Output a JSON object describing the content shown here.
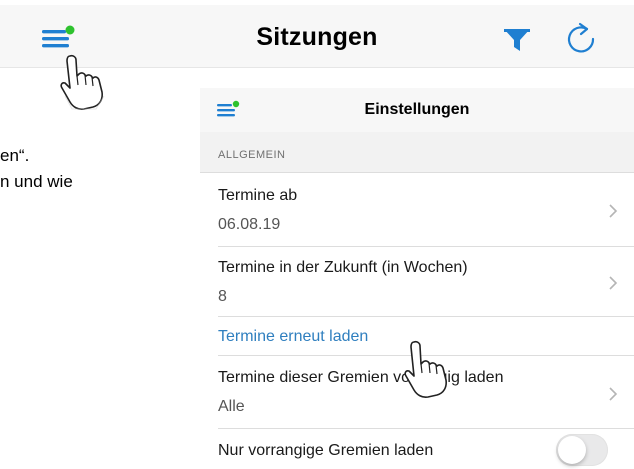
{
  "topbar": {
    "title": "Sitzungen",
    "menu_icon": "hamburger-menu-icon",
    "filter_icon": "filter-funnel-icon",
    "refresh_icon": "refresh-icon",
    "accent_color": "#1f7fd1",
    "badge_color": "#2ec22e"
  },
  "background_text": {
    "line1": "en“.",
    "line2": "n und wie"
  },
  "settings": {
    "title": "Einstellungen",
    "section_header": "ALLGEMEIN",
    "rows": [
      {
        "label": "Termine ab",
        "value": "06.08.19"
      },
      {
        "label": "Termine in der Zukunft (in Wochen)",
        "value": "8"
      },
      {
        "label": "Termine erneut laden"
      },
      {
        "label": "Termine dieser Gremien vorrangig laden",
        "value": "Alle"
      },
      {
        "label": "Nur vorrangige Gremien laden",
        "toggle_on": false
      }
    ]
  }
}
